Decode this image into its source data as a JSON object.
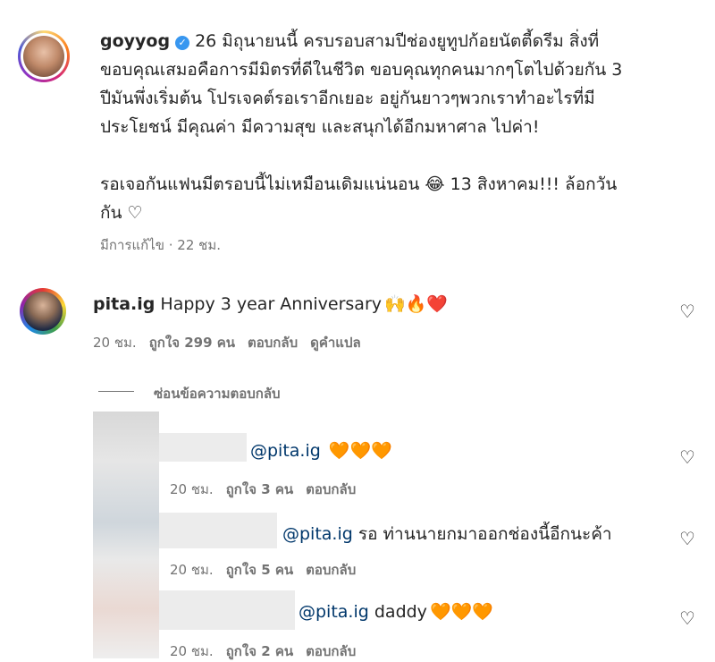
{
  "post": {
    "username": "goyyog",
    "caption_lines": [
      "26 มิถุนายนนี้ ครบรอบสามปีช่องยูทูปก้อยนัตตี้ดรีม สิ่งที่",
      "ขอบคุณเสมอคือการมีมิตรที่ดีในชีวิต ขอบคุณทุกคนมากๆโตไปด้วยกัน 3",
      "ปีมันพึ่งเริ่มต้น โปรเจคต์รอเราอีกเยอะ อยู่กันยาวๆพวกเราทำอะไรที่มี",
      "ประโยชน์ มีคุณค่า มีความสุข และสนุกได้อีกมหาศาล ไปค่า!",
      "",
      "รอเจอกันแฟนมีตรอบนี้ไม่เหมือนเดิมแน่นอน 😂 13 สิงหาคม!!! ล้อกวัน",
      "กัน ♡"
    ],
    "edited_label": "มีการแก้ไข · 22 ชม."
  },
  "main_comment": {
    "username": "pita.ig",
    "text": "Happy 3 year Anniversary",
    "emojis": "🙌🔥❤️",
    "time": "20 ชม.",
    "likes": "ถูกใจ 299 คน",
    "reply_label": "ตอบกลับ",
    "translate_label": "ดูคำแปล",
    "hide_replies_label": "ซ่อนข้อความตอบกลับ"
  },
  "replies": [
    {
      "mention": "@pita.ig",
      "text": "",
      "emojis": "🧡🧡🧡",
      "time": "20 ชม.",
      "likes": "ถูกใจ 3 คน",
      "reply_label": "ตอบกลับ"
    },
    {
      "mention": "@pita.ig",
      "text": "รอ ท่านนายกมาออกช่องนี้อีกนะค้า",
      "emojis": "",
      "time": "20 ชม.",
      "likes": "ถูกใจ 5 คน",
      "reply_label": "ตอบกลับ"
    },
    {
      "mention": "@pita.ig",
      "text": "daddy",
      "emojis": "🧡🧡🧡",
      "time": "20 ชม.",
      "likes": "ถูกใจ 2 คน",
      "reply_label": "ตอบกลับ"
    }
  ],
  "icons": {
    "heart": "heart-outline-icon",
    "verified": "verified-badge-icon"
  }
}
